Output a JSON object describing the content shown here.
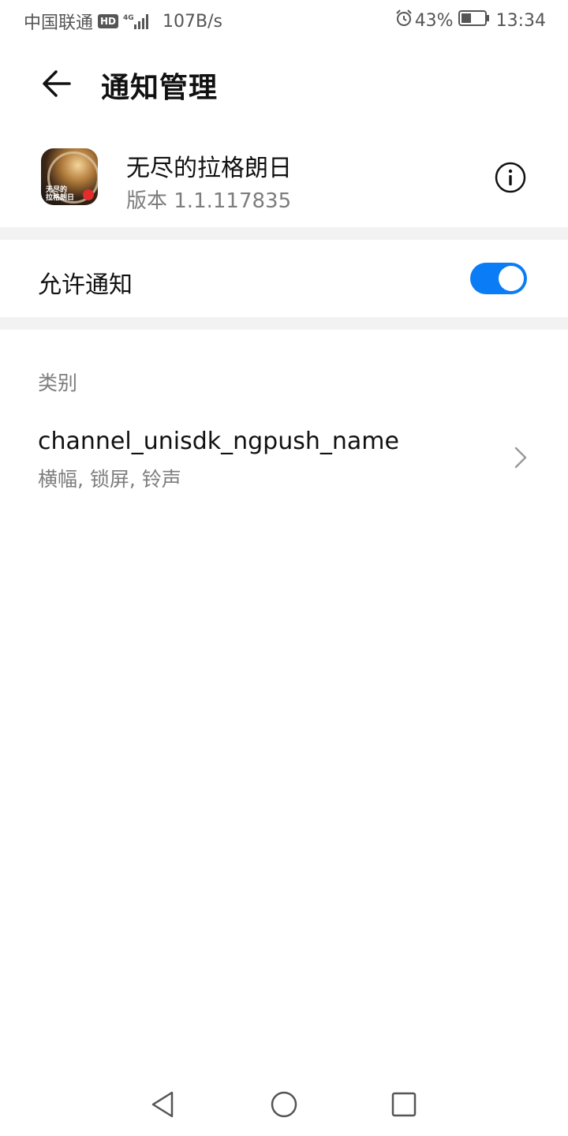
{
  "status_bar": {
    "carrier": "中国联通",
    "hd_badge": "HD",
    "network": "4G",
    "speed": "107B/s",
    "battery_percent": "43%",
    "battery_level": 0.43,
    "time": "13:34"
  },
  "header": {
    "title": "通知管理"
  },
  "app": {
    "name": "无尽的拉格朗日",
    "version": "版本 1.1.117835",
    "icon_text_line1": "无尽的",
    "icon_text_line2": "拉格朗日"
  },
  "notifications": {
    "allow_label": "允许通知",
    "allow_enabled": true
  },
  "category": {
    "section_label": "类别",
    "channel": {
      "name": "channel_unisdk_ngpush_name",
      "description": "横幅, 锁屏, 铃声"
    }
  },
  "colors": {
    "accent": "#0a7cf5",
    "secondary_text": "#7d7d7d",
    "divider": "#f2f2f2"
  },
  "icons": {
    "back": "arrow-left-icon",
    "info": "info-circle-icon",
    "chevron": "chevron-right-icon",
    "alarm": "alarm-icon",
    "battery": "battery-icon",
    "signal": "signal-icon",
    "nav_back": "triangle-back-icon",
    "nav_home": "circle-home-icon",
    "nav_recent": "square-recent-icon"
  }
}
